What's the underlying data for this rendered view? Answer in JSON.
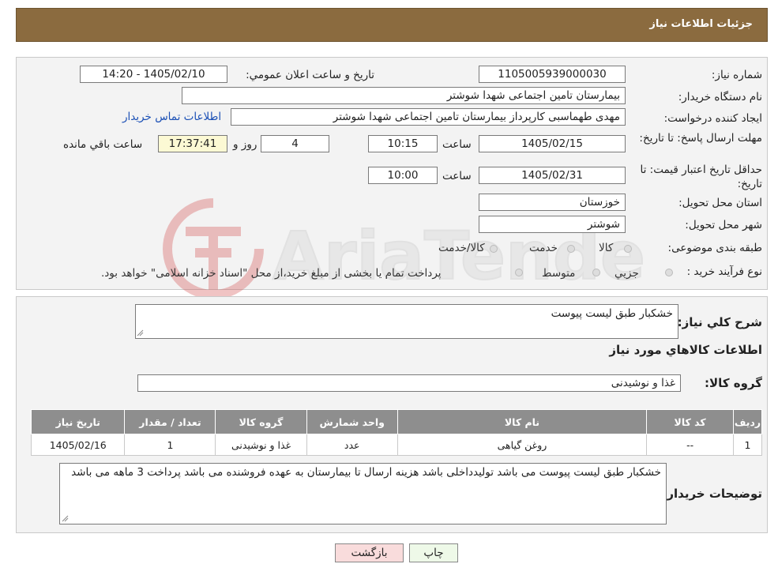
{
  "header": {
    "title": "جزئیات اطلاعات نیاز"
  },
  "form": {
    "need_number_label": "شماره نیاز:",
    "need_number": "1105005939000030",
    "announce_label": "تاریخ و ساعت اعلان عمومي:",
    "announce_value": "1405/02/10 - 14:20",
    "buyer_org_label": "نام دستگاه خریدار:",
    "buyer_org": "بیمارستان تامین اجتماعی شهدا شوشتر",
    "creator_label": "ایجاد کننده درخواست:",
    "creator": "مهدی طهماسبی کارپرداز بیمارستان تامین اجتماعی شهدا شوشتر",
    "contact_link": "اطلاعات تماس خریدار",
    "reply_deadline_label": "مهلت ارسال پاسخ: تا تاریخ:",
    "reply_date": "1405/02/15",
    "time_label": "ساعت",
    "reply_time": "10:15",
    "days_value": "4",
    "days_label": "روز و",
    "remaining_value": "17:37:41",
    "remaining_label": "ساعت باقي مانده",
    "price_validity_label": "حداقل تاریخ اعتبار قیمت: تا تاریخ:",
    "price_date": "1405/02/31",
    "price_time_label": "ساعت",
    "price_time": "10:00",
    "province_label": "استان محل تحویل:",
    "province": "خوزستان",
    "city_label": "شهر محل تحویل:",
    "city": "شوشتر",
    "category_label": "طبقه بندی موضوعی:",
    "category_options": [
      "کالا",
      "خدمت",
      "کالا/خدمت"
    ],
    "process_label": "نوع فرآیند خرید :",
    "process_options": [
      "جزیي",
      "متوسط"
    ],
    "process_note": "پرداخت تمام یا بخشی از مبلغ خرید،از محل \"اسناد خزانه اسلامی\" خواهد بود."
  },
  "description": {
    "label": "شرح کلي نياز:",
    "value": "خشکبار طبق لیست پیوست"
  },
  "goods_info": {
    "title": "اطلاعات كالاهاي مورد نياز",
    "group_label": "گروه کالا:",
    "group_value": "غذا و نوشیدنی"
  },
  "table": {
    "headers": [
      "رديف",
      "کد کالا",
      "نام کالا",
      "واحد شمارش",
      "گروه کالا",
      "تعداد / مقدار",
      "تاریخ نیاز"
    ],
    "rows": [
      [
        "1",
        "--",
        "روغن گیاهی",
        "عدد",
        "غذا و نوشیدنی",
        "1",
        "1405/02/16"
      ]
    ]
  },
  "buyer_notes": {
    "label": "توضیحات خریدار:",
    "value": "خشکبار طبق لیست پیوست می باشد تولیدداخلی باشد هزینه ارسال تا بیمارستان به عهده فروشنده می باشد پرداخت 3 ماهه می باشد"
  },
  "buttons": {
    "print": "چاپ",
    "back": "بازگشت"
  },
  "watermark": {
    "text": "AriaTender.neT"
  },
  "colors": {
    "header_bg": "#8b6b3f",
    "table_header_bg": "#8e8e8e",
    "remaining_bg": "#fcf9d4",
    "back_button_bg": "#f9dcdc",
    "print_button_bg": "#eef9e8",
    "link": "#1a4fb5"
  }
}
